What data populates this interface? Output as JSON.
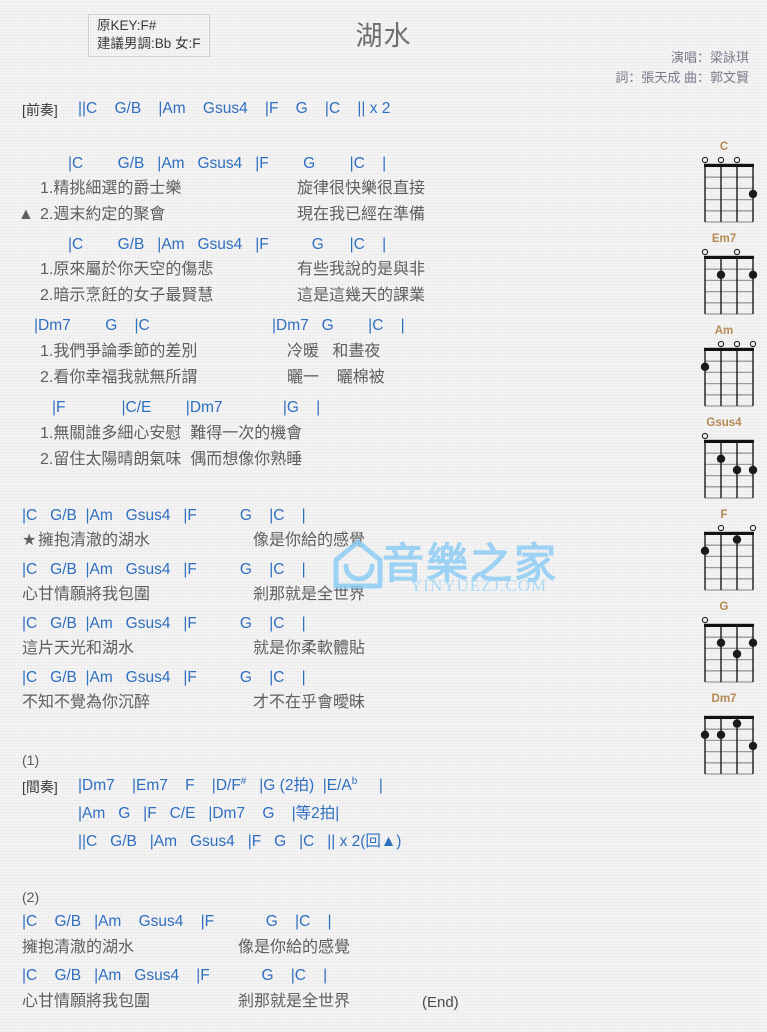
{
  "header": {
    "key_original": "原KEY:F#",
    "key_suggested": "建議男調:Bb 女:F",
    "title": "湖水",
    "singer": "演唱：梁詠琪",
    "writers": "詞：張天成   曲：郭文賢"
  },
  "watermark": {
    "cn": "音樂之家",
    "en": "YINYUEZJ.COM"
  },
  "lines": {
    "intro_tag": "[前奏]",
    "intro_chords": "||C    G/B    |Am    Gsus4    |F    G    |C    || x 2",
    "v1_chords_1": "|C        G/B   |Am   Gsus4   |F        G        |C    |",
    "v1_lyric_1a": "1.精挑細選的爵士樂",
    "v1_lyric_1a_r": "旋律很快樂很直接",
    "v1_marker_2": "▲",
    "v1_lyric_1b": "2.週末約定的聚會",
    "v1_lyric_1b_r": "現在我已經在準備",
    "v1_chords_2": "|C        G/B   |Am   Gsus4   |F          G      |C    |",
    "v1_lyric_2a": "1.原來屬於你天空的傷悲",
    "v1_lyric_2a_r": "有些我說的是與非",
    "v1_lyric_2b": "2.暗示烹飪的女子最賢慧",
    "v1_lyric_2b_r": "這是這幾天的課業",
    "v1_chords_3": "|Dm7        G    |C",
    "v1_chords_3r": "|Dm7   G        |C    |",
    "v1_lyric_3a": "1.我們爭論季節的差別",
    "v1_lyric_3a_r": "冷暖   和晝夜",
    "v1_lyric_3b": "2.看你幸福我就無所謂",
    "v1_lyric_3b_r": "曬一    曬棉被",
    "v1_chords_4": "|F             |C/E        |Dm7              |G    |",
    "v1_lyric_4a": "1.無關誰多細心安慰  難得一次的機會",
    "v1_lyric_4b": "2.留住太陽晴朗氣味  偶而想像你熟睡",
    "ch_chords_1": "|C   G/B  |Am   Gsus4   |F          G    |C    |",
    "ch_marker": "★",
    "ch_lyric_1": "擁抱清澈的湖水",
    "ch_lyric_1r": "像是你給的感覺",
    "ch_chords_2": "|C   G/B  |Am   Gsus4   |F          G    |C    |",
    "ch_lyric_2": "心甘情願將我包圍",
    "ch_lyric_2r": "剎那就是全世界",
    "ch_chords_3": "|C   G/B  |Am   Gsus4   |F          G    |C    |",
    "ch_lyric_3": "這片天光和湖水",
    "ch_lyric_3r": "就是你柔軟體貼",
    "ch_chords_4": "|C   G/B  |Am   Gsus4   |F          G    |C    |",
    "ch_lyric_4": "不知不覺為你沉醉",
    "ch_lyric_4r": "才不在乎會曖昧",
    "mark_1": "(1)",
    "interlude_tag": "[間奏]",
    "interlude_1_a": "|Dm7    |Em7    F    |D/F",
    "interlude_1_sup": "#",
    "interlude_1_b": "   |G (2拍)  |E/A",
    "interlude_1_sup2": "b",
    "interlude_1_c": "     |",
    "interlude_2": "|Am   G   |F   C/E   |Dm7    G    |等2拍|",
    "interlude_3": "||C   G/B   |Am   Gsus4   |F   G   |C   || x 2(回▲)",
    "mark_2": "(2)",
    "end_chords_1": "|C    G/B   |Am    Gsus4    |F            G    |C    |",
    "end_lyric_1": "擁抱清澈的湖水",
    "end_lyric_1r": "像是你給的感覺",
    "end_chords_2": "|C    G/B   |Am   Gsus4    |F            G    |C    |",
    "end_lyric_2": "心甘情願將我包圍",
    "end_lyric_2r": "剎那就是全世界",
    "end_label": "(End)"
  },
  "chord_diagrams": [
    {
      "name": "C",
      "open": [
        1,
        2,
        3
      ],
      "muted": [],
      "dots": [
        {
          "string": 4,
          "fret": 3
        }
      ]
    },
    {
      "name": "Em7",
      "open": [
        1,
        3
      ],
      "muted": [],
      "dots": [
        {
          "string": 2,
          "fret": 2
        },
        {
          "string": 4,
          "fret": 2
        }
      ]
    },
    {
      "name": "Am",
      "open": [
        2,
        3,
        4
      ],
      "muted": [],
      "dots": [
        {
          "string": 1,
          "fret": 2
        }
      ]
    },
    {
      "name": "Gsus4",
      "open": [
        1
      ],
      "muted": [],
      "dots": [
        {
          "string": 2,
          "fret": 2
        },
        {
          "string": 3,
          "fret": 3
        },
        {
          "string": 4,
          "fret": 3
        }
      ]
    },
    {
      "name": "F",
      "open": [
        2,
        4
      ],
      "muted": [],
      "dots": [
        {
          "string": 3,
          "fret": 1
        },
        {
          "string": 1,
          "fret": 2
        }
      ]
    },
    {
      "name": "G",
      "open": [
        1
      ],
      "muted": [],
      "dots": [
        {
          "string": 2,
          "fret": 2
        },
        {
          "string": 4,
          "fret": 2
        },
        {
          "string": 3,
          "fret": 3
        }
      ]
    },
    {
      "name": "Dm7",
      "open": [],
      "muted": [],
      "dots": [
        {
          "string": 3,
          "fret": 1
        },
        {
          "string": 1,
          "fret": 2
        },
        {
          "string": 2,
          "fret": 2
        },
        {
          "string": 4,
          "fret": 3
        }
      ]
    }
  ],
  "colors": {
    "chord_blue": "#2f6fc0",
    "lyric_gray": "#5e5e5e",
    "chord_name_gold": "#b58a52",
    "watermark_blue": "#8ecdf5"
  }
}
